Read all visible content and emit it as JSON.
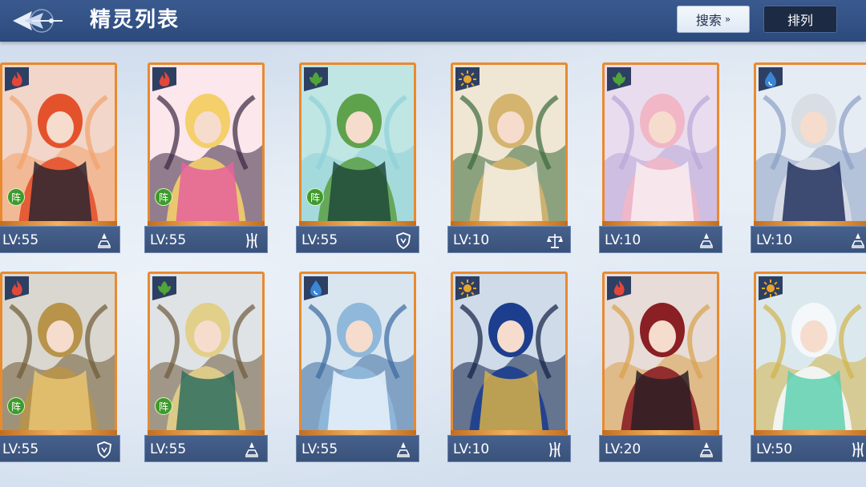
{
  "header": {
    "title": "精灵列表",
    "search_label": "搜索",
    "sort_label": "排列"
  },
  "colors": {
    "topbar": "#2c4a7c",
    "card_frame": "#e98a2e",
    "fire": "#e2473a",
    "nature": "#4fa53a",
    "light": "#e8a52c",
    "water": "#3a86d6"
  },
  "cards": [
    {
      "level": "LV:55",
      "element": "fire-icon",
      "class_icon": "mage-icon",
      "formation_badge": "阵",
      "art": "red-haired-winged-girl"
    },
    {
      "level": "LV:55",
      "element": "fire-icon",
      "class_icon": "claw-icon",
      "formation_badge": "阵",
      "art": "blonde-cat-eared-girl"
    },
    {
      "level": "LV:55",
      "element": "nature-icon",
      "class_icon": "shield-icon",
      "formation_badge": "阵",
      "art": "green-haired-warrior"
    },
    {
      "level": "LV:10",
      "element": "light-icon",
      "class_icon": "balance-icon",
      "formation_badge": "",
      "art": "golden-antlered-elf"
    },
    {
      "level": "LV:10",
      "element": "nature-icon",
      "class_icon": "mage-icon",
      "formation_badge": "",
      "art": "pink-haired-fairy"
    },
    {
      "level": "LV:10",
      "element": "water-icon",
      "class_icon": "mage-icon",
      "formation_badge": "",
      "art": "silver-haired-elf"
    },
    {
      "level": "LV:55",
      "element": "fire-icon",
      "class_icon": "shield-icon",
      "formation_badge": "阵",
      "art": "golden-dragon"
    },
    {
      "level": "LV:55",
      "element": "nature-icon",
      "class_icon": "mage-icon",
      "formation_badge": "阵",
      "art": "horned-blonde-man"
    },
    {
      "level": "LV:55",
      "element": "water-icon",
      "class_icon": "mage-icon",
      "formation_badge": "",
      "art": "ice-crystal-dragon"
    },
    {
      "level": "LV:10",
      "element": "light-icon",
      "class_icon": "claw-icon",
      "formation_badge": "",
      "art": "blue-armored-dragon"
    },
    {
      "level": "LV:20",
      "element": "fire-icon",
      "class_icon": "mage-icon",
      "formation_badge": "",
      "art": "dark-red-beast"
    },
    {
      "level": "LV:50",
      "element": "light-icon",
      "class_icon": "claw-icon",
      "formation_badge": "",
      "art": "white-crystal-dragon"
    }
  ]
}
